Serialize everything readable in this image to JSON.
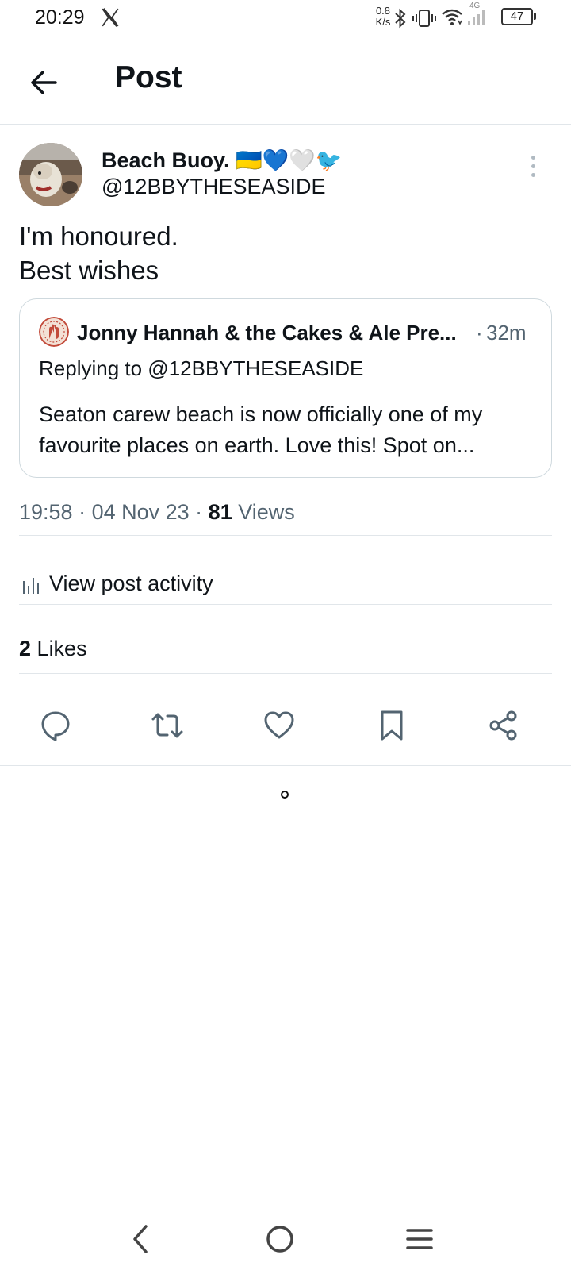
{
  "status_bar": {
    "time": "20:29",
    "net_speed_value": "0.8",
    "net_speed_unit": "K/s",
    "network_type": "4G",
    "battery": "47"
  },
  "header": {
    "title": "Post"
  },
  "post": {
    "author_name": "Beach Buoy. 🇺🇦💙🤍🐦",
    "author_handle": "@12BBYTHESEASIDE",
    "text_line1": "I'm honoured.",
    "text_line2": "Best wishes",
    "quote": {
      "author": "Jonny Hannah & the Cakes & Ale Pre...",
      "separator": "·",
      "time": "32m",
      "replying_to": "Replying to @12BBYTHESEASIDE",
      "text": "Seaton carew beach is now officially one of my favourite places on earth. Love this! Spot on..."
    },
    "time": "19:58",
    "date": "04 Nov 23",
    "views_count": "81",
    "views_label": "Views",
    "activity_label": "View post activity",
    "likes_count": "2",
    "likes_label": "Likes"
  },
  "colors": {
    "text": "#0f1419",
    "muted": "#536471",
    "divider": "#e1e6ea",
    "icon": "#536471"
  },
  "icons": {
    "back": "arrow-left-icon",
    "more": "more-vertical-icon",
    "reply": "reply-icon",
    "repost": "repost-icon",
    "like": "heart-icon",
    "bookmark": "bookmark-icon",
    "share": "share-icon",
    "activity": "bar-chart-icon"
  }
}
